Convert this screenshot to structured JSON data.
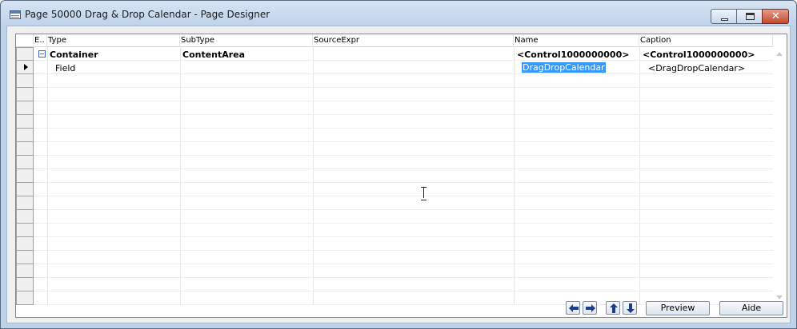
{
  "window": {
    "title": "Page 50000 Drag & Drop Calendar - Page Designer"
  },
  "grid": {
    "columns": [
      "E..",
      "Type",
      "SubType",
      "SourceExpr",
      "Name",
      "Caption"
    ],
    "rows": [
      {
        "expander": "collapse",
        "type": "Container",
        "subtype": "ContentArea",
        "sourceexpr": "",
        "name": "<Control1000000000>",
        "caption": "<Control1000000000>",
        "bold": true
      },
      {
        "expander": "",
        "type": "Field",
        "subtype": "",
        "sourceexpr": "",
        "name": "DragDropCalendar",
        "caption": "<DragDropCalendar>",
        "bold": false,
        "current": true
      }
    ],
    "empty_row_count": 17
  },
  "buttons": {
    "preview": "Preview",
    "aide": "Aide"
  },
  "colors": {
    "selection": "#3399ff",
    "window_frame": "#bed3ea",
    "arrow_blue": "#1c3c8c"
  }
}
